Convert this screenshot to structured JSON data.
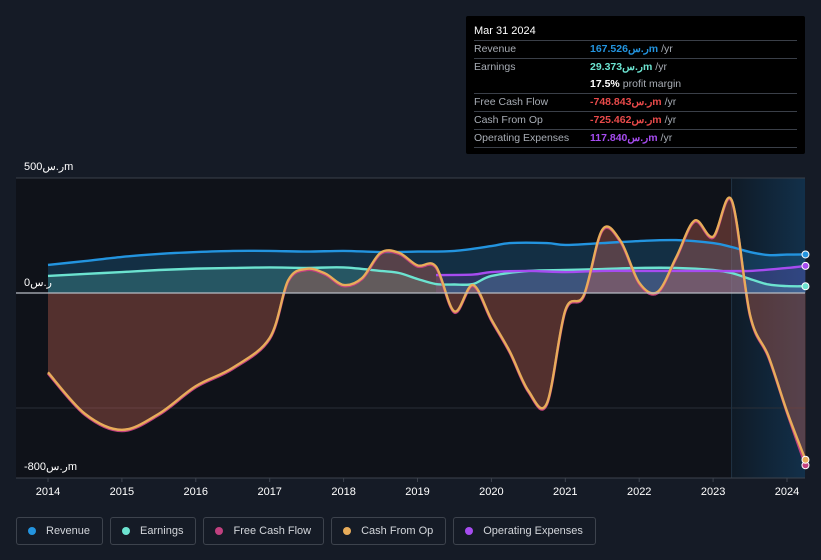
{
  "tooltip": {
    "date": "Mar 31 2024",
    "rows": [
      {
        "label": "Revenue",
        "value": "167.526ر.سm",
        "unit": "/yr",
        "color": "#2394df"
      },
      {
        "label": "Earnings",
        "value": "29.373ر.سm",
        "unit": "/yr",
        "color": "#6ce3d0"
      },
      {
        "label": "",
        "value": "17.5%",
        "unit": "profit margin",
        "color": "#ffffff"
      },
      {
        "label": "Free Cash Flow",
        "value": "-748.843ر.سm",
        "unit": "/yr",
        "color": "#e84a4a"
      },
      {
        "label": "Cash From Op",
        "value": "-725.462ر.سm",
        "unit": "/yr",
        "color": "#e84a4a"
      },
      {
        "label": "Operating Expenses",
        "value": "117.840ر.سm",
        "unit": "/yr",
        "color": "#a64cf0"
      }
    ]
  },
  "legend": [
    {
      "label": "Revenue",
      "color": "#2394df"
    },
    {
      "label": "Earnings",
      "color": "#6ce3d0"
    },
    {
      "label": "Free Cash Flow",
      "color": "#c0407f"
    },
    {
      "label": "Cash From Op",
      "color": "#e8ac5a"
    },
    {
      "label": "Operating Expenses",
      "color": "#a64cf0"
    }
  ],
  "chart_data": {
    "type": "area",
    "title": "",
    "xlabel": "",
    "ylabel": "",
    "currency_unit": "ر.سm",
    "y_tick_labels": [
      "500ر.سm",
      "0ر.س",
      "-800ر.سm"
    ],
    "y_ticks": [
      500,
      0,
      -800
    ],
    "ylim": [
      -800,
      500
    ],
    "xlim": [
      2013.7,
      2024.25
    ],
    "x_tick_labels": [
      "2014",
      "2015",
      "2016",
      "2017",
      "2018",
      "2019",
      "2020",
      "2021",
      "2022",
      "2023",
      "2024"
    ],
    "highlight_from": 2023.25,
    "grid": true,
    "legend_position": "bottom",
    "series": [
      {
        "name": "Revenue",
        "color": "#2394df",
        "x": [
          2014.0,
          2014.5,
          2015.0,
          2015.5,
          2016.0,
          2016.5,
          2017.0,
          2017.5,
          2018.0,
          2018.5,
          2019.0,
          2019.5,
          2020.0,
          2020.25,
          2020.75,
          2021.0,
          2021.5,
          2022.0,
          2022.5,
          2023.0,
          2023.25,
          2023.5,
          2023.75,
          2024.0,
          2024.25
        ],
        "y": [
          122,
          139,
          157,
          170,
          178,
          183,
          183,
          180,
          183,
          178,
          180,
          183,
          204,
          217,
          217,
          209,
          217,
          226,
          230,
          217,
          200,
          178,
          165,
          167,
          167.5
        ]
      },
      {
        "name": "Earnings",
        "color": "#6ce3d0",
        "x": [
          2014.0,
          2014.5,
          2015.0,
          2015.5,
          2016.0,
          2016.5,
          2017.0,
          2017.5,
          2018.0,
          2018.5,
          2018.75,
          2019.0,
          2019.25,
          2019.5,
          2019.75,
          2020.0,
          2020.5,
          2021.0,
          2021.5,
          2022.0,
          2022.5,
          2023.0,
          2023.25,
          2023.5,
          2023.75,
          2024.0,
          2024.25
        ],
        "y": [
          74,
          83,
          91,
          100,
          106,
          109,
          111,
          109,
          111,
          96,
          87,
          61,
          39,
          37,
          39,
          74,
          96,
          100,
          104,
          109,
          109,
          100,
          87,
          61,
          37,
          30,
          29.4
        ]
      },
      {
        "name": "Free Cash Flow",
        "color": "#c0407f",
        "x": [
          2014.0,
          2014.5,
          2015.0,
          2015.5,
          2016.0,
          2016.5,
          2017.0,
          2017.25,
          2017.5,
          2017.75,
          2018.0,
          2018.25,
          2018.5,
          2018.75,
          2019.0,
          2019.25,
          2019.5,
          2019.75,
          2020.0,
          2020.25,
          2020.5,
          2020.75,
          2021.0,
          2021.25,
          2021.5,
          2021.75,
          2022.0,
          2022.25,
          2022.5,
          2022.75,
          2023.0,
          2023.25,
          2023.5,
          2023.75,
          2024.0,
          2024.25
        ],
        "y": [
          -350,
          -530,
          -600,
          -530,
          -410,
          -330,
          -200,
          50,
          100,
          80,
          30,
          60,
          170,
          170,
          115,
          110,
          -85,
          30,
          -120,
          -260,
          -430,
          -485,
          -80,
          -15,
          270,
          220,
          40,
          0,
          150,
          310,
          240,
          400,
          -100,
          -280,
          -520,
          -749
        ]
      },
      {
        "name": "Cash From Op",
        "color": "#e8ac5a",
        "x": [
          2014.0,
          2014.5,
          2015.0,
          2015.5,
          2016.0,
          2016.5,
          2017.0,
          2017.25,
          2017.5,
          2017.75,
          2018.0,
          2018.25,
          2018.5,
          2018.75,
          2019.0,
          2019.25,
          2019.5,
          2019.75,
          2020.0,
          2020.25,
          2020.5,
          2020.75,
          2021.0,
          2021.25,
          2021.5,
          2021.75,
          2022.0,
          2022.25,
          2022.5,
          2022.75,
          2023.0,
          2023.25,
          2023.5,
          2023.75,
          2024.0,
          2024.25
        ],
        "y": [
          -345,
          -525,
          -595,
          -525,
          -405,
          -325,
          -195,
          55,
          105,
          85,
          35,
          65,
          175,
          175,
          120,
          115,
          -80,
          35,
          -115,
          -255,
          -425,
          -480,
          -75,
          -10,
          275,
          225,
          45,
          5,
          155,
          315,
          245,
          405,
          -95,
          -275,
          -515,
          -725
        ]
      },
      {
        "name": "Operating Expenses",
        "color": "#a64cf0",
        "x": [
          2019.25,
          2019.75,
          2020.0,
          2020.5,
          2021.0,
          2021.5,
          2022.0,
          2022.5,
          2023.0,
          2023.5,
          2024.0,
          2024.25
        ],
        "y": [
          78,
          80,
          91,
          96,
          91,
          96,
          96,
          96,
          96,
          96,
          109,
          117.8
        ]
      }
    ]
  }
}
